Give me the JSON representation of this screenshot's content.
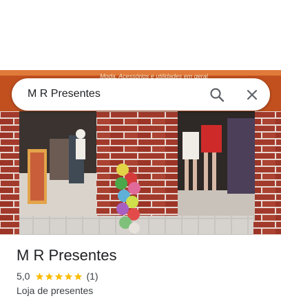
{
  "search": {
    "query": "M R Presentes",
    "search_icon": "search-icon",
    "close_icon": "close-icon"
  },
  "photo": {
    "sign_text": "Moda, Acessórios e utilidades em geral"
  },
  "place": {
    "title": "M R Presentes",
    "rating": "5,0",
    "stars": 5,
    "review_count": "(1)",
    "category": "Loja de presentes"
  },
  "colors": {
    "star": "#fbbc04",
    "brick": "#a23a2c",
    "mortar": "#e8d9d2"
  }
}
